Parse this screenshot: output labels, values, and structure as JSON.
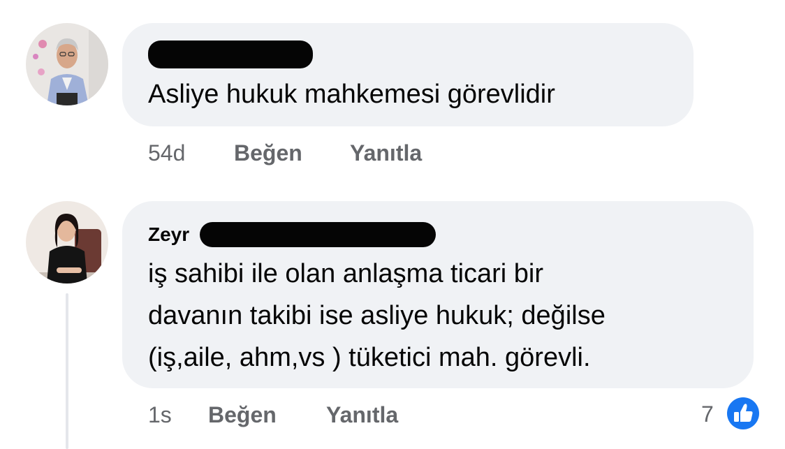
{
  "comments": [
    {
      "author": "",
      "text": "Asliye hukuk mahkemesi görevlidir",
      "time": "54d",
      "like_label": "Beğen",
      "reply_label": "Yanıtla"
    },
    {
      "author": "Zeyr",
      "text_lines": [
        "iş sahibi ile olan anlaşma ticari bir",
        "davanın takibi ise asliye hukuk; değilse",
        "(iş,aile, ahm,vs ) tüketici mah. görevli."
      ],
      "time": "1s",
      "like_label": "Beğen",
      "reply_label": "Yanıtla",
      "reaction_count": "7",
      "reaction_icon": "like-thumbs-up-icon"
    }
  ],
  "colors": {
    "bubble_bg": "#f0f2f5",
    "text": "#050505",
    "meta": "#65676b",
    "like_blue": "#1877f2"
  }
}
